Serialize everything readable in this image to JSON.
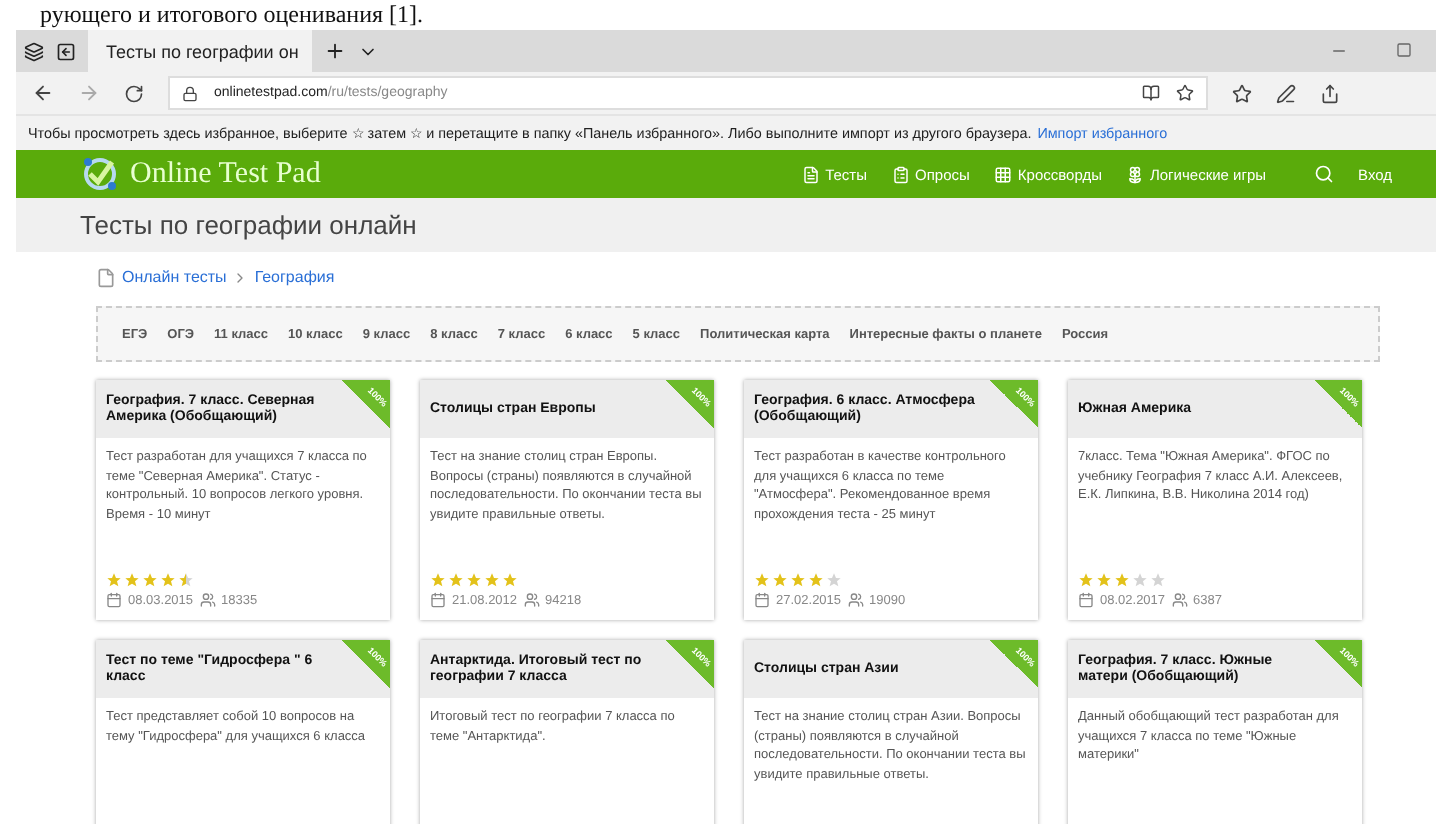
{
  "document_text": "рующего и итогового оценивания [1].",
  "browser": {
    "tab_title": "Тесты по географии он",
    "url_domain": "onlinetestpad.com",
    "url_path": "/ru/tests/geography"
  },
  "favorites_bar": {
    "message": "Чтобы просмотреть здесь избранное, выберите  ☆  затем ☆ и перетащите в папку «Панель избранного». Либо выполните импорт из другого браузера.",
    "link": "Импорт избранного"
  },
  "site": {
    "logo": "Online Test Pad",
    "nav": [
      {
        "kind": "tests",
        "label": "Тесты"
      },
      {
        "kind": "polls",
        "label": "Опросы"
      },
      {
        "kind": "crosswords",
        "label": "Кроссворды"
      },
      {
        "kind": "games",
        "label": "Логические игры"
      }
    ],
    "login": "Вход"
  },
  "page_title": "Тесты по географии онлайн",
  "breadcrumbs": [
    "Онлайн тесты",
    "География"
  ],
  "filters": [
    "ЕГЭ",
    "ОГЭ",
    "11 класс",
    "10 класс",
    "9 класс",
    "8 класс",
    "7 класс",
    "6 класс",
    "5 класс",
    "Политическая карта",
    "Интересные факты о планете",
    "Россия"
  ],
  "cards": [
    {
      "title": "География. 7 класс. Северная Америка (Обобщающий)",
      "badge": "100%",
      "description": "Тест разработан для учащихся 7 класса по теме \"Северная Америка\". Статус - контрольный. 10 вопросов легкого уровня. Время - 10 минут",
      "stars": 4.5,
      "date": "08.03.2015",
      "views": "18335"
    },
    {
      "title": "Столицы стран Европы",
      "badge": "100%",
      "description": "Тест на знание столиц стран Европы. Вопросы (страны) появляются в случайной последовательности. По окончании теста вы увидите правильные ответы.",
      "stars": 5,
      "date": "21.08.2012",
      "views": "94218"
    },
    {
      "title": "География. 6 класс. Атмосфера (Обобщающий)",
      "badge": "100%",
      "description": "Тест разработан в качестве контрольного для учащихся 6 класса по теме \"Атмосфера\". Рекомендованное время прохождения теста - 25 минут",
      "stars": 4,
      "date": "27.02.2015",
      "views": "19090"
    },
    {
      "title": "Южная Америка",
      "badge": "100%",
      "description": "7класс. Тема \"Южная Америка\". ФГОС по учебнику География 7 класс А.И. Алексеев, Е.К. Липкина, В.В. Николина 2014 год)",
      "stars": 3,
      "date": "08.02.2017",
      "views": "6387"
    },
    {
      "title": "Тест по теме \"Гидросфера \" 6 класс",
      "badge": "100%",
      "description": "Тест представляет собой 10 вопросов на тему \"Гидросфера\" для учащихся 6 класса"
    },
    {
      "title": "Антарктида. Итоговый тест по географии 7 класса",
      "badge": "100%",
      "description": "Итоговый тест по географии 7 класса по теме \"Антарктида\"."
    },
    {
      "title": "Столицы стран Азии",
      "badge": "100%",
      "description": "Тест на знание столиц стран Азии. Вопросы (страны) появляются в случайной последовательности. По окончании теста вы увидите правильные ответы."
    },
    {
      "title": "География. 7 класс. Южные матери (Обобщающий)",
      "badge": "100%",
      "description": "Данный обобщающий тест разработан для учащихся 7 класса по теме \"Южные материки\""
    }
  ]
}
